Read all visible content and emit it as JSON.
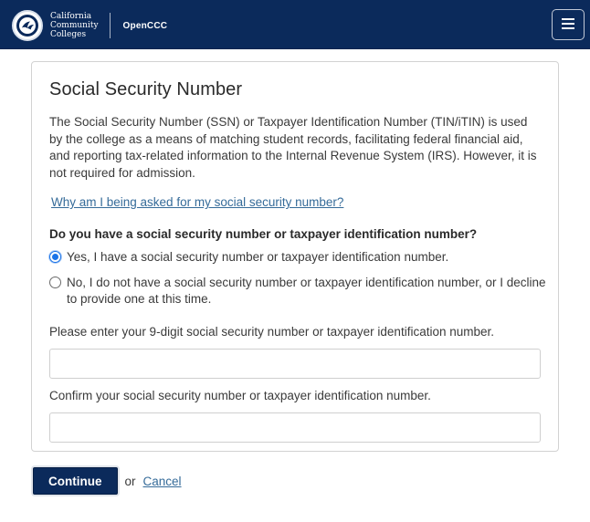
{
  "header": {
    "logo_lines": [
      "California",
      "Community",
      "Colleges"
    ],
    "app_name": "OpenCCC",
    "menu_icon": "hamburger-menu-icon",
    "background_color": "#0b2a5b"
  },
  "card": {
    "title": "Social Security Number",
    "description": "The Social Security Number (SSN) or Taxpayer Identification Number (TIN/iTIN) is used by the college as a means of matching student records, facilitating federal financial aid, and reporting tax-related information to the Internal Revenue System (IRS). However, it is not required for admission.",
    "why_link": "Why am I being asked for my social security number?",
    "question": "Do you have a social security number or taxpayer identification number?",
    "options": [
      {
        "label": "Yes, I have a social security number or taxpayer identification number.",
        "checked": true
      },
      {
        "label": "No, I do not have a social security number or taxpayer identification number, or I decline to provide one at this time.",
        "checked": false
      }
    ],
    "fields": [
      {
        "label": "Please enter your 9-digit social security number or taxpayer identification number.",
        "value": "",
        "placeholder": ""
      },
      {
        "label": "Confirm your social security number or taxpayer identification number.",
        "value": "",
        "placeholder": ""
      }
    ]
  },
  "actions": {
    "continue_label": "Continue",
    "or_text": "or",
    "cancel_label": "Cancel"
  },
  "colors": {
    "primary": "#0b2a5b",
    "link": "#356b99",
    "radio_checked": "#1a73e8"
  }
}
